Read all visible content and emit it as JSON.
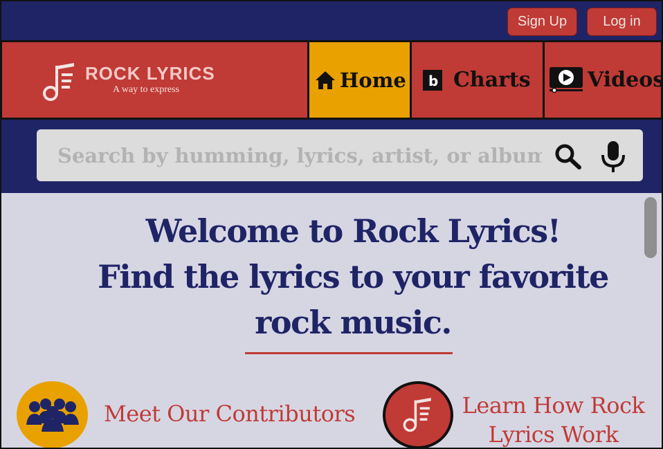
{
  "auth": {
    "signup_label": "Sign Up",
    "login_label": "Log in"
  },
  "brand": {
    "name": "ROCK LYRICS",
    "tagline": "A way to express"
  },
  "nav": {
    "home": "Home",
    "charts": "Charts",
    "videos": "Videos"
  },
  "search": {
    "placeholder": "Search by humming, lyrics, artist, or album"
  },
  "welcome": {
    "line1": "Welcome to Rock Lyrics!",
    "line2": "Find the lyrics to your favorite",
    "line3": "rock music."
  },
  "features": {
    "contributors": "Meet Our Contributors",
    "learn_line1": "Learn How Rock",
    "learn_line2": "Lyrics Work"
  },
  "colors": {
    "navy": "#1f2466",
    "red": "#c03a36",
    "gold": "#e9a100",
    "panel": "#d6d6e3"
  }
}
